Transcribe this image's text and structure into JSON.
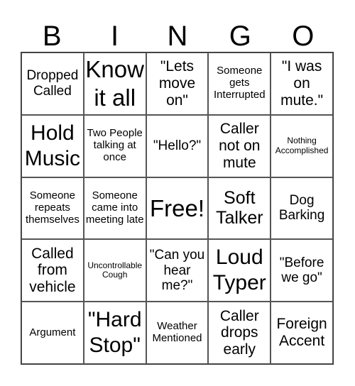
{
  "header": {
    "letters": [
      "B",
      "I",
      "N",
      "G",
      "O"
    ]
  },
  "cells": [
    "Dropped Called",
    "Know it all",
    "\"Lets move on\"",
    "Someone gets Interrupted",
    "\"I was on mute.\"",
    "Hold Music",
    "Two People talking at once",
    "\"Hello?\"",
    "Caller not on mute",
    "Nothing Accomplished",
    "Someone repeats themselves",
    "Someone came into meeting late",
    "Free!",
    "Soft Talker",
    "Dog Barking",
    "Called from vehicle",
    "Uncontrollable Cough",
    "\"Can you hear me?\"",
    "Loud Typer",
    "\"Before we go\"",
    "Argument",
    "\"Hard Stop\"",
    "Weather Mentioned",
    "Caller drops early",
    "Foreign Accent"
  ]
}
